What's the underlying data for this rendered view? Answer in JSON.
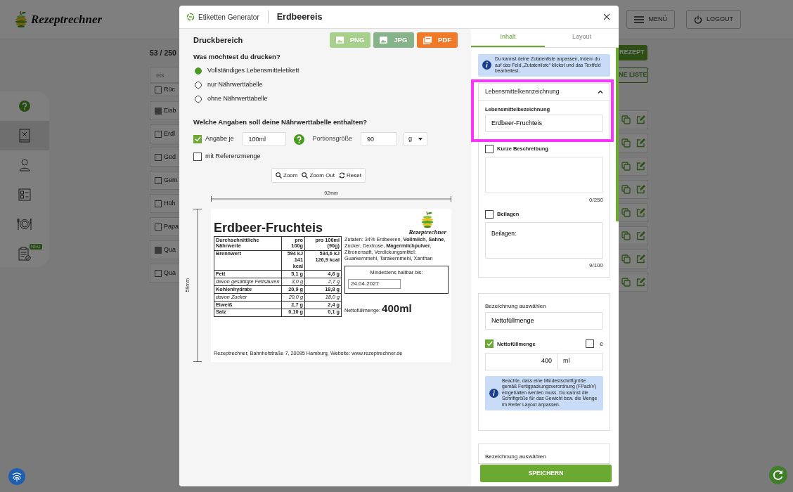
{
  "header": {
    "logo": "Rezeptrechner",
    "menu_button": "MENÜ",
    "logout_button": "LOGOUT"
  },
  "sidebar": {
    "items": [
      {
        "kind": "help",
        "selected": false
      },
      {
        "kind": "recipes",
        "selected": true
      },
      {
        "kind": "user",
        "selected": false
      },
      {
        "kind": "checklist",
        "selected": false
      },
      {
        "kind": "meals",
        "selected": false
      },
      {
        "kind": "report",
        "selected": false,
        "badge": "NEU"
      }
    ]
  },
  "recipe_list": {
    "count": "53 / 250",
    "search": "eis",
    "new_button": "REZEPT",
    "list_button": "NE LISTE",
    "rows": [
      {
        "label": "Rüc",
        "checked": false,
        "has_actions": false
      },
      {
        "label": "Eisb",
        "checked": true,
        "has_actions": true
      },
      {
        "label": "Erdl",
        "checked": false,
        "has_actions": true
      },
      {
        "label": "Ged",
        "checked": false,
        "has_actions": true
      },
      {
        "label": "Gem",
        "checked": false,
        "has_actions": true
      },
      {
        "label": "Hüh",
        "checked": false,
        "has_actions": true
      },
      {
        "label": "Papa",
        "checked": false,
        "has_actions": true
      },
      {
        "label": "Qua",
        "checked": true,
        "has_actions": true
      },
      {
        "label": "Qua",
        "checked": false,
        "has_actions": true
      }
    ]
  },
  "modal": {
    "app_title": "Etiketten Generator",
    "title": "Erdbeereis"
  },
  "print_area": {
    "heading": "Druckbereich",
    "export_buttons": [
      {
        "label": "PNG",
        "kind": "image",
        "color": "#a8d08d"
      },
      {
        "label": "JPG",
        "kind": "image",
        "color": "#86b38a"
      },
      {
        "label": "PDF",
        "kind": "pdf",
        "color": "#f07a2a"
      }
    ],
    "question": "Was möchtest du drucken?",
    "options": [
      {
        "label": "Vollständiges Lebensmitteletikett",
        "selected": true
      },
      {
        "label": "nur Nährwerttabelle",
        "selected": false
      },
      {
        "label": "ohne Nährwerttabelle",
        "selected": false
      }
    ]
  },
  "nutrition_options": {
    "question": "Welche Angaben soll deine Nährwerttabelle enthalten?",
    "per_amount": {
      "label": "Angabe je",
      "checked": true,
      "value": "100ml"
    },
    "portion": {
      "label": "Portionsgröße",
      "value": "90",
      "unit": "g"
    },
    "reference": {
      "label": "mit Referenzmenge",
      "checked": false
    }
  },
  "zoom_toolbar": [
    {
      "label": "Zoom",
      "kind": "zoom-in"
    },
    {
      "label": "Zoom Out",
      "kind": "zoom-out"
    },
    {
      "label": "Reset",
      "kind": "reset"
    }
  ],
  "label_preview": {
    "width": "92mm",
    "height": "59mm",
    "title": "Erdbeer-Fruchteis",
    "logo": "Rezeptrechner",
    "table": {
      "columns": [
        "Durchschnittliche Nährwerte",
        "pro 100g",
        "pro 100ml (90g)"
      ],
      "rows": [
        {
          "kind": "main",
          "name": "Brennwert",
          "values": [
            [
              "594 kJ",
              "141 kcal"
            ],
            [
              "534,6 kJ",
              "126,9 kcal"
            ]
          ]
        },
        {
          "kind": "main",
          "name": "Fett",
          "values": [
            [
              "5,1 g"
            ],
            [
              "4,6 g"
            ]
          ]
        },
        {
          "kind": "sub",
          "name": "davon gesättigte Fettsäuren",
          "values": [
            [
              "3,0 g"
            ],
            [
              "2,7 g"
            ]
          ]
        },
        {
          "kind": "main",
          "name": "Kohlenhydrate",
          "values": [
            [
              "20,9 g"
            ],
            [
              "18,8 g"
            ]
          ]
        },
        {
          "kind": "sub",
          "name": "davon Zucker",
          "values": [
            [
              "20,0 g"
            ],
            [
              "18,0 g"
            ]
          ]
        },
        {
          "kind": "main",
          "name": "Eiweiß",
          "values": [
            [
              "2,7 g"
            ],
            [
              "2,4 g"
            ]
          ]
        },
        {
          "kind": "main",
          "name": "Salz",
          "values": [
            [
              "0,10 g"
            ],
            [
              "0,1 g"
            ]
          ]
        }
      ]
    },
    "ingredients": "Zutaten: 34% Erdbeeren, **Vollmilch**, **Sahne**, Zucker, Dextrose, **Magermilchpulver**, Zitronensaft, Verdickungsmittel: Guarkernmehl, Tarakernmehl, Xanthan",
    "best_before": {
      "label": "Mindestens haltbar bis:",
      "value": "24.04.2027"
    },
    "net_quantity": {
      "label": "Nettofüllmenge:",
      "value": "400ml"
    },
    "footer": "Rezeptrechner, Bahnhofstraße 7, 20095 Hamburg, Website: www.rezeptrechner.de"
  },
  "editor": {
    "tabs": [
      {
        "label": "Inhalt",
        "selected": true
      },
      {
        "label": "Layout",
        "selected": false
      }
    ],
    "info": "Du kannst deine Zutatenliste anpassen, indem du auf das Feld „Zutatenliste“ klickst und das Textfeld bearbeitest.",
    "section": {
      "title": "Lebensmittelkennzeichnung",
      "expanded": true,
      "highlighted": true,
      "name_label": "Lebensmittelbezeichnung",
      "name_value": "Erdbeer-Fruchteis"
    },
    "description": {
      "label": "Kurze Beschreibung",
      "checked": false,
      "counter": "0/250"
    },
    "sides": {
      "label": "Beilagen",
      "checked": false,
      "value": "Beilagen:",
      "counter": "9/100"
    },
    "quantity": {
      "select_label": "Bezeichnung auswählen",
      "select_value": "Nettofüllmenge",
      "label": "Nettofüllmenge",
      "checked": true,
      "e_label": "e",
      "e_checked": false,
      "amount": "400",
      "unit": "ml",
      "note": "Beachte, dass eine Mindestschriftgröße gemäß Fertigpackungsverordnung (FPackV) eingehalten werden muss. Du kannst die Schriftgröße für das Gewicht bzw. die Menge im Reiter Layout anpassen."
    },
    "next_select_label": "Bezeichnung auswählen",
    "save_button": "SPEICHERN"
  }
}
